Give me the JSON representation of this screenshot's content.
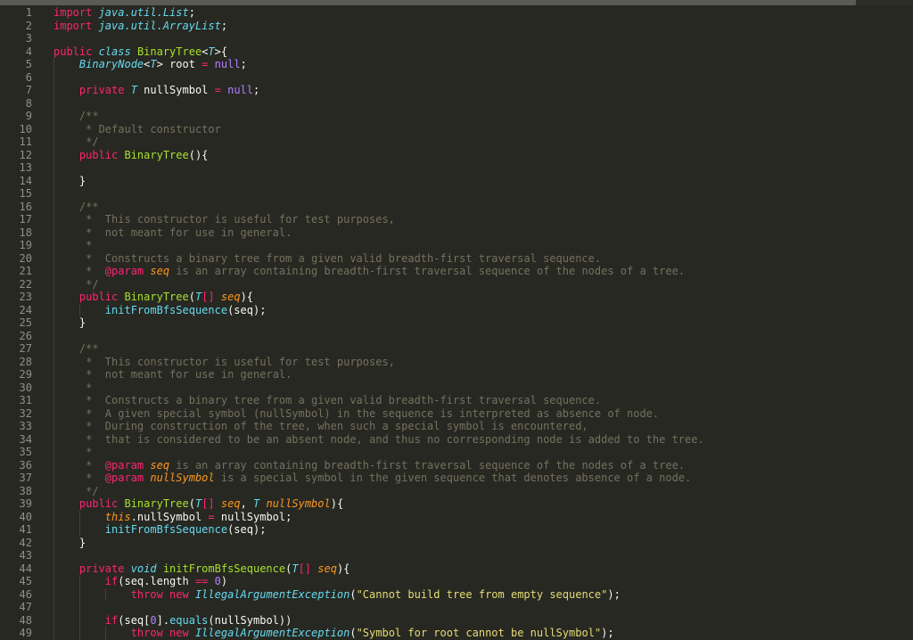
{
  "editor": {
    "theme": "monokai",
    "colors": {
      "background": "#272822",
      "keyword": "#f92672",
      "type": "#66d9ef",
      "function": "#a6e22e",
      "parameter": "#fd971f",
      "string": "#e6db74",
      "number": "#ae81ff",
      "comment": "#75715e",
      "plain": "#f8f8f2",
      "line_number": "#8f908a"
    },
    "lines": [
      [
        [
          "kw",
          "import "
        ],
        [
          "type",
          "java.util.List"
        ],
        [
          "pl",
          ";"
        ]
      ],
      [
        [
          "kw",
          "import "
        ],
        [
          "type",
          "java.util.ArrayList"
        ],
        [
          "pl",
          ";"
        ]
      ],
      [],
      [
        [
          "kw",
          "public "
        ],
        [
          "type",
          "class "
        ],
        [
          "cls",
          "BinaryTree"
        ],
        [
          "pl",
          "<"
        ],
        [
          "type",
          "T"
        ],
        [
          "pl",
          ">{"
        ]
      ],
      [
        [
          "pl",
          "    "
        ],
        [
          "type",
          "BinaryNode"
        ],
        [
          "pl",
          "<"
        ],
        [
          "type",
          "T"
        ],
        [
          "pl",
          "> root "
        ],
        [
          "kw",
          "="
        ],
        [
          "null",
          " null"
        ],
        [
          "pl",
          ";"
        ]
      ],
      [],
      [
        [
          "pl",
          "    "
        ],
        [
          "kw",
          "private "
        ],
        [
          "type",
          "T"
        ],
        [
          "pl",
          " nullSymbol "
        ],
        [
          "kw",
          "="
        ],
        [
          "null",
          " null"
        ],
        [
          "pl",
          ";"
        ]
      ],
      [],
      [
        [
          "com",
          "    /**"
        ]
      ],
      [
        [
          "com",
          "     * Default constructor"
        ]
      ],
      [
        [
          "com",
          "     */"
        ]
      ],
      [
        [
          "pl",
          "    "
        ],
        [
          "kw",
          "public "
        ],
        [
          "fn",
          "BinaryTree"
        ],
        [
          "pl",
          "(){"
        ]
      ],
      [],
      [
        [
          "pl",
          "    }"
        ]
      ],
      [],
      [
        [
          "com",
          "    /**"
        ]
      ],
      [
        [
          "com",
          "     *  This constructor is useful for test purposes,"
        ]
      ],
      [
        [
          "com",
          "     *  not meant for use in general."
        ]
      ],
      [
        [
          "com",
          "     *"
        ]
      ],
      [
        [
          "com",
          "     *  Constructs a binary tree from a given valid breadth-first traversal sequence."
        ]
      ],
      [
        [
          "com",
          "     *  "
        ],
        [
          "ann",
          "@param "
        ],
        [
          "param",
          "seq"
        ],
        [
          "com",
          " is an array containing breadth-first traversal sequence of the nodes of a tree."
        ]
      ],
      [
        [
          "com",
          "     */"
        ]
      ],
      [
        [
          "pl",
          "    "
        ],
        [
          "kw",
          "public "
        ],
        [
          "fn",
          "BinaryTree"
        ],
        [
          "pl",
          "("
        ],
        [
          "type",
          "T"
        ],
        [
          "kw",
          "[] "
        ],
        [
          "param",
          "seq"
        ],
        [
          "pl",
          "){"
        ]
      ],
      [
        [
          "pl",
          "        "
        ],
        [
          "type-n",
          "initFromBfsSequence"
        ],
        [
          "pl",
          "(seq);"
        ]
      ],
      [
        [
          "pl",
          "    }"
        ]
      ],
      [],
      [
        [
          "com",
          "    /**"
        ]
      ],
      [
        [
          "com",
          "     *  This constructor is useful for test purposes,"
        ]
      ],
      [
        [
          "com",
          "     *  not meant for use in general."
        ]
      ],
      [
        [
          "com",
          "     *"
        ]
      ],
      [
        [
          "com",
          "     *  Constructs a binary tree from a given valid breadth-first traversal sequence."
        ]
      ],
      [
        [
          "com",
          "     *  A given special symbol (nullSymbol) in the sequence is interpreted as absence of node."
        ]
      ],
      [
        [
          "com",
          "     *  During construction of the tree, when such a special symbol is encountered,"
        ]
      ],
      [
        [
          "com",
          "     *  that is considered to be an absent node, and thus no corresponding node is added to the tree."
        ]
      ],
      [
        [
          "com",
          "     *"
        ]
      ],
      [
        [
          "com",
          "     *  "
        ],
        [
          "ann",
          "@param "
        ],
        [
          "param",
          "seq"
        ],
        [
          "com",
          " is an array containing breadth-first traversal sequence of the nodes of a tree."
        ]
      ],
      [
        [
          "com",
          "     *  "
        ],
        [
          "ann",
          "@param "
        ],
        [
          "param",
          "nullSymbol"
        ],
        [
          "com",
          " is a special symbol in the given sequence that denotes absence of a node."
        ]
      ],
      [
        [
          "com",
          "     */"
        ]
      ],
      [
        [
          "pl",
          "    "
        ],
        [
          "kw",
          "public "
        ],
        [
          "fn",
          "BinaryTree"
        ],
        [
          "pl",
          "("
        ],
        [
          "type",
          "T"
        ],
        [
          "kw",
          "[] "
        ],
        [
          "param",
          "seq"
        ],
        [
          "pl",
          ", "
        ],
        [
          "type",
          "T "
        ],
        [
          "param",
          "nullSymbol"
        ],
        [
          "pl",
          "){"
        ]
      ],
      [
        [
          "pl",
          "        "
        ],
        [
          "this",
          "this"
        ],
        [
          "pl",
          ".nullSymbol "
        ],
        [
          "kw",
          "="
        ],
        [
          "pl",
          " nullSymbol;"
        ]
      ],
      [
        [
          "pl",
          "        "
        ],
        [
          "type-n",
          "initFromBfsSequence"
        ],
        [
          "pl",
          "(seq);"
        ]
      ],
      [
        [
          "pl",
          "    }"
        ]
      ],
      [],
      [
        [
          "pl",
          "    "
        ],
        [
          "kw",
          "private "
        ],
        [
          "type",
          "void "
        ],
        [
          "fn",
          "initFromBfsSequence"
        ],
        [
          "pl",
          "("
        ],
        [
          "type",
          "T"
        ],
        [
          "kw",
          "[] "
        ],
        [
          "param",
          "seq"
        ],
        [
          "pl",
          "){"
        ]
      ],
      [
        [
          "pl",
          "        "
        ],
        [
          "kw",
          "if"
        ],
        [
          "pl",
          "(seq.length "
        ],
        [
          "kw",
          "=="
        ],
        [
          "num",
          " 0"
        ],
        [
          "pl",
          ")"
        ]
      ],
      [
        [
          "pl",
          "            "
        ],
        [
          "kw",
          "throw new "
        ],
        [
          "ex",
          "IllegalArgumentException"
        ],
        [
          "pl",
          "("
        ],
        [
          "str",
          "\"Cannot build tree from empty sequence\""
        ],
        [
          "pl",
          ");"
        ]
      ],
      [],
      [
        [
          "pl",
          "        "
        ],
        [
          "kw",
          "if"
        ],
        [
          "pl",
          "(seq["
        ],
        [
          "num",
          "0"
        ],
        [
          "pl",
          "]."
        ],
        [
          "type-n",
          "equals"
        ],
        [
          "pl",
          "(nullSymbol))"
        ]
      ],
      [
        [
          "pl",
          "            "
        ],
        [
          "kw",
          "throw new "
        ],
        [
          "ex",
          "IllegalArgumentException"
        ],
        [
          "pl",
          "("
        ],
        [
          "str",
          "\"Symbol for root cannot be nullSymbol\""
        ],
        [
          "pl",
          ");"
        ]
      ]
    ]
  }
}
